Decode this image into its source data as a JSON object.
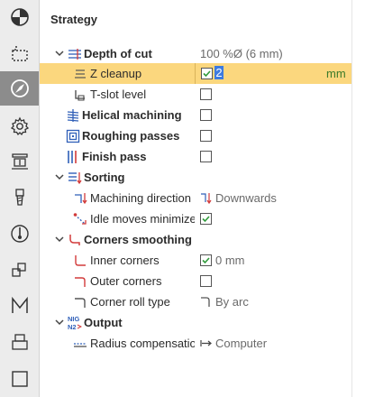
{
  "panel": {
    "title": "Strategy"
  },
  "sidebar": {
    "items": [
      {
        "icon": "half-circle-icon"
      },
      {
        "icon": "dashed-square-icon"
      },
      {
        "icon": "compass-icon",
        "active": true
      },
      {
        "icon": "gear-icon"
      },
      {
        "icon": "machine-table-icon"
      },
      {
        "icon": "tool-icon"
      },
      {
        "icon": "spindle-icon"
      },
      {
        "icon": "cubes-icon"
      },
      {
        "icon": "m-code-icon"
      },
      {
        "icon": "printer-icon"
      },
      {
        "icon": "square-icon"
      }
    ]
  },
  "tree": {
    "depth_of_cut": {
      "label": "Depth of cut",
      "value": "100 %Ø (6 mm)"
    },
    "z_cleanup": {
      "label": "Z cleanup",
      "value": "2",
      "unit": "mm",
      "checked": true
    },
    "t_slot": {
      "label": "T-slot level",
      "checked": false
    },
    "helical": {
      "label": "Helical machining",
      "checked": false
    },
    "roughing": {
      "label": "Roughing passes",
      "checked": false
    },
    "finish": {
      "label": "Finish pass",
      "checked": false
    },
    "sorting": {
      "label": "Sorting"
    },
    "machining_direction": {
      "label": "Machining direction",
      "value": "Downwards"
    },
    "idle_moves": {
      "label": "Idle moves minimize",
      "checked": true
    },
    "corners": {
      "label": "Corners smoothing"
    },
    "inner_corners": {
      "label": "Inner corners",
      "value": "0 mm",
      "checked": true
    },
    "outer_corners": {
      "label": "Outer corners",
      "checked": false
    },
    "corner_roll": {
      "label": "Corner roll type",
      "value": "By arc"
    },
    "output": {
      "label": "Output"
    },
    "radius_comp": {
      "label": "Radius compensation",
      "value": "Computer"
    }
  },
  "colors": {
    "selected_row": "#fbd77e",
    "active_sidebar": "#8c8c8c",
    "accent_blue": "#3d7be0",
    "unit_green": "#3a7a2a",
    "icon_red": "#d23b3b",
    "icon_blue": "#2f5fb8"
  }
}
